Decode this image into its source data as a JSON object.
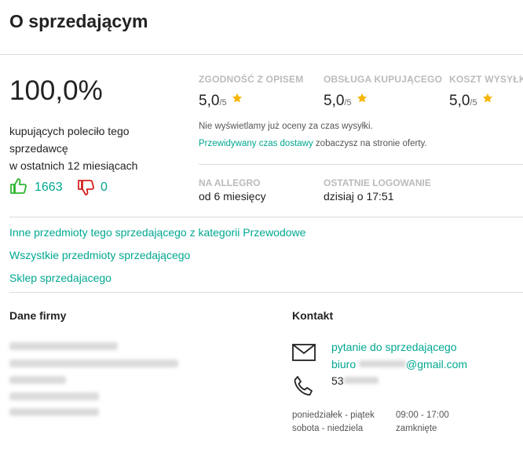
{
  "header": {
    "title": "O sprzedającym"
  },
  "recommendation": {
    "percent": "100,0%",
    "line1": "kupujących poleciło tego sprzedawcę",
    "line2": "w ostatnich 12 miesiącach",
    "positive_count": "1663",
    "negative_count": "0"
  },
  "ratings": [
    {
      "label": "ZGODNOŚĆ Z OPISEM",
      "value": "5,0",
      "of": "/5"
    },
    {
      "label": "OBSŁUGA KUPUJĄCEGO",
      "value": "5,0",
      "of": "/5"
    },
    {
      "label": "KOSZT WYSYŁKI",
      "value": "5,0",
      "of": "/5"
    }
  ],
  "shipping_note": {
    "line1": "Nie wyświetlamy już oceny za czas wysyłki.",
    "link": "Przewidywany czas dostawy",
    "line2_rest": " zobaczysz na stronie oferty."
  },
  "seller_info": {
    "on_allegro_label": "NA ALLEGRO",
    "on_allegro_value": "od 6 miesięcy",
    "last_login_label": "OSTATNIE LOGOWANIE",
    "last_login_value": "dzisiaj o 17:51"
  },
  "links": {
    "other_items_category": "Inne przedmioty tego sprzedającego z kategorii Przewodowe",
    "all_items": "Wszystkie przedmioty sprzedającego",
    "shop": "Sklep sprzedajacego"
  },
  "company": {
    "heading": "Dane firmy"
  },
  "contact": {
    "heading": "Kontakt",
    "ask_link": "pytanie do sprzedającego",
    "email_prefix": "biuro",
    "email_suffix": "@gmail.com",
    "phone_prefix": "53",
    "hours": [
      {
        "days": "poniedziałek - piątek",
        "time": "09:00 - 17:00"
      },
      {
        "days": "sobota - niedziela",
        "time": "zamknięte"
      }
    ]
  },
  "colors": {
    "accent": "#00a790",
    "positive": "#2cb52c",
    "negative": "#d42020",
    "star": "#f7b500"
  }
}
